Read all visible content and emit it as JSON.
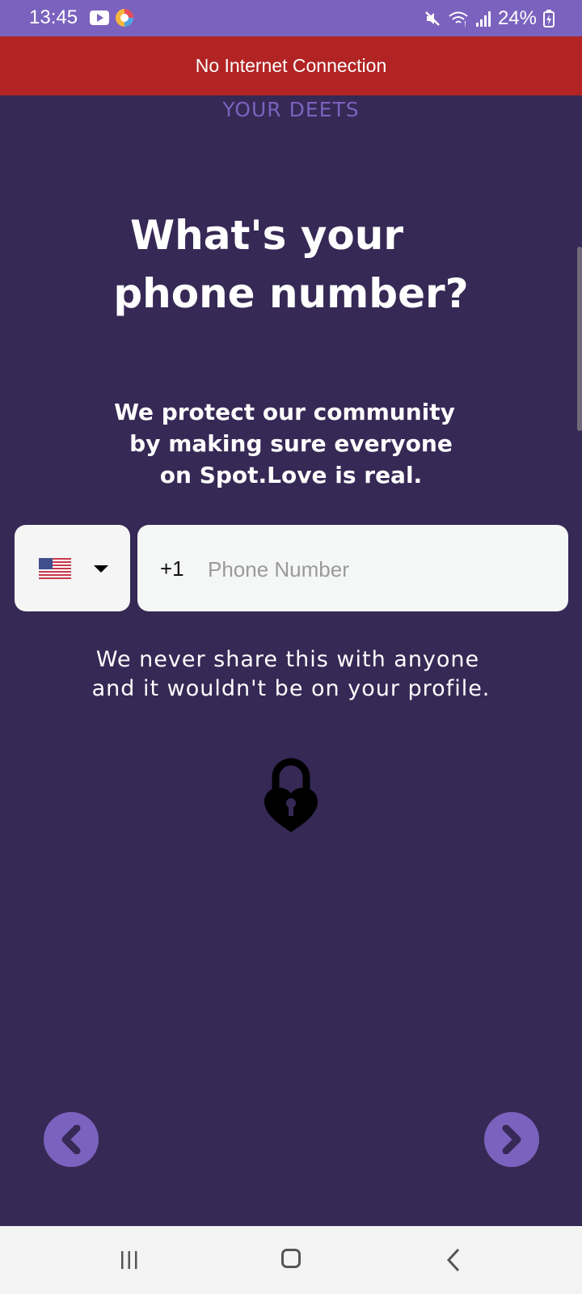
{
  "status_bar": {
    "time": "13:45",
    "battery": "24%",
    "icons": [
      "youtube-icon",
      "app-icon",
      "mute-icon",
      "wifi-icon",
      "signal-icon",
      "battery-icon"
    ]
  },
  "banner": {
    "text": "No Internet Connection",
    "color": "#B22424"
  },
  "section_label": "YOUR DEETS",
  "title": {
    "line1": "What's your",
    "line2": "phone number?"
  },
  "subtitle": {
    "line1": "We protect our community",
    "line2": "by making sure everyone",
    "line3": "on Spot.Love is real."
  },
  "phone_form": {
    "country_flag": "🇺🇸",
    "dial_code": "+1",
    "phone_value": "",
    "phone_placeholder": "Phone Number"
  },
  "privacy": {
    "line1": "We never share this with anyone",
    "line2": "and it wouldn't be on your profile."
  },
  "nav": {
    "back_icon": "chevron-left-icon",
    "next_icon": "chevron-right-icon"
  },
  "colors": {
    "background": "#362955",
    "accent": "#7B62BE",
    "banner": "#B22424"
  }
}
